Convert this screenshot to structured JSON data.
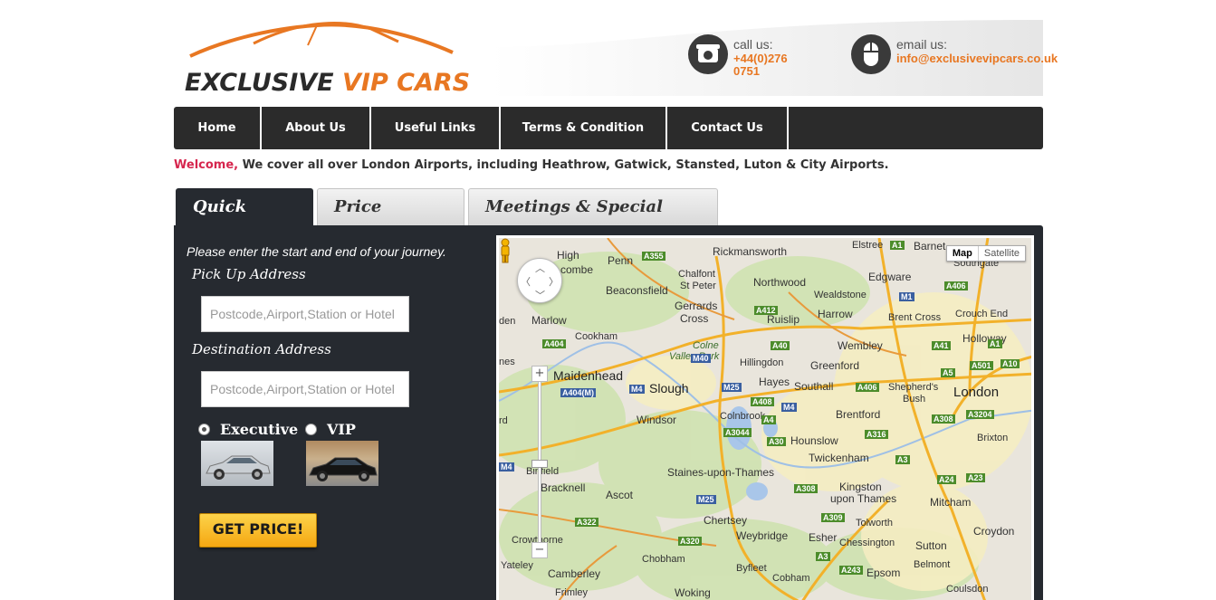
{
  "header": {
    "logo": {
      "word1": "EXCLUSIVE",
      "word2": "VIP CARS"
    },
    "call": {
      "label": "call us:",
      "value": "+44(0)276 0751"
    },
    "email": {
      "label": "email us:",
      "value": "info@exclusivevipcars.co.uk"
    }
  },
  "nav": {
    "items": [
      {
        "label": "Home"
      },
      {
        "label": "About Us"
      },
      {
        "label": "Useful Links"
      },
      {
        "label": "Terms & Condition"
      },
      {
        "label": "Contact Us"
      }
    ]
  },
  "welcome": {
    "greeting": "Welcome,",
    "text": "We cover all over London Airports, including Heathrow, Gatwick, Stansted, Luton & City Airports."
  },
  "tabs": [
    {
      "label": "Quick Quote",
      "active": true
    },
    {
      "label": "Price Enquiry",
      "active": false
    },
    {
      "label": "Meetings & Special Events",
      "active": false
    }
  ],
  "quote_form": {
    "intro": "Please enter the start and end of your journey.",
    "pickup_label": "Pick Up Address",
    "pickup_placeholder": "Postcode,Airport,Station or Hotel",
    "dest_label": "Destination Address",
    "dest_placeholder": "Postcode,Airport,Station or Hotel",
    "options": [
      {
        "label": "Executive",
        "selected": true
      },
      {
        "label": "VIP",
        "selected": false
      }
    ],
    "submit_label": "GET PRICE!"
  },
  "map": {
    "type_buttons": [
      "Map",
      "Satellite"
    ],
    "places": [
      {
        "name": "High Wycombe"
      },
      {
        "name": "Penn"
      },
      {
        "name": "Rickmansworth"
      },
      {
        "name": "Barnet"
      },
      {
        "name": "Elstree"
      },
      {
        "name": "Edgware"
      },
      {
        "name": "Southgate"
      },
      {
        "name": "Chalfont St Peter"
      },
      {
        "name": "Beaconsfield"
      },
      {
        "name": "Northwood"
      },
      {
        "name": "Wealdstone"
      },
      {
        "name": "Gerrards Cross"
      },
      {
        "name": "Ruislip"
      },
      {
        "name": "Harrow"
      },
      {
        "name": "Brent Cross"
      },
      {
        "name": "Crouch End"
      },
      {
        "name": "Marlow"
      },
      {
        "name": "Cookham"
      },
      {
        "name": "Colne Valley Park"
      },
      {
        "name": "Hillingdon"
      },
      {
        "name": "Wembley"
      },
      {
        "name": "Holloway"
      },
      {
        "name": "Maidenhead"
      },
      {
        "name": "Hayes"
      },
      {
        "name": "Greenford"
      },
      {
        "name": "Slough"
      },
      {
        "name": "Southall"
      },
      {
        "name": "Shepherd's Bush"
      },
      {
        "name": "London"
      },
      {
        "name": "Windsor"
      },
      {
        "name": "Colnbrook"
      },
      {
        "name": "Brentford"
      },
      {
        "name": "Hounslow"
      },
      {
        "name": "Brixton"
      },
      {
        "name": "Twickenham"
      },
      {
        "name": "Binfield"
      },
      {
        "name": "Staines-upon-Thames"
      },
      {
        "name": "Bracknell"
      },
      {
        "name": "Ascot"
      },
      {
        "name": "Kingston upon Thames"
      },
      {
        "name": "Mitcham"
      },
      {
        "name": "Chertsey"
      },
      {
        "name": "Tolworth"
      },
      {
        "name": "Croydon"
      },
      {
        "name": "Crowthorne"
      },
      {
        "name": "Weybridge"
      },
      {
        "name": "Esher"
      },
      {
        "name": "Chessington"
      },
      {
        "name": "Sutton"
      },
      {
        "name": "Chobham"
      },
      {
        "name": "Yateley"
      },
      {
        "name": "Camberley"
      },
      {
        "name": "Byfleet"
      },
      {
        "name": "Cobham"
      },
      {
        "name": "Epsom"
      },
      {
        "name": "Belmont"
      },
      {
        "name": "Coulsdon"
      },
      {
        "name": "Frimley"
      },
      {
        "name": "Woking"
      },
      {
        "name": "rd"
      },
      {
        "name": "nes"
      },
      {
        "name": "den"
      }
    ],
    "road_signs": [
      "A1",
      "A355",
      "A412",
      "A406",
      "M1",
      "A404",
      "M40",
      "A40",
      "A41",
      "A1",
      "A501",
      "A10",
      "A404(M)",
      "M4",
      "M25",
      "A408",
      "M4",
      "A406",
      "A5",
      "A4",
      "A3044",
      "A30",
      "A316",
      "A308",
      "A3204",
      "A3",
      "A24",
      "A23",
      "M4",
      "M25",
      "A308",
      "A322",
      "A309",
      "A320",
      "A3",
      "A243"
    ]
  },
  "colors": {
    "brand_orange": "#e87722",
    "nav_bg": "#2b2b2b",
    "panel_bg": "#262a30",
    "welcome_red": "#d6264e"
  }
}
